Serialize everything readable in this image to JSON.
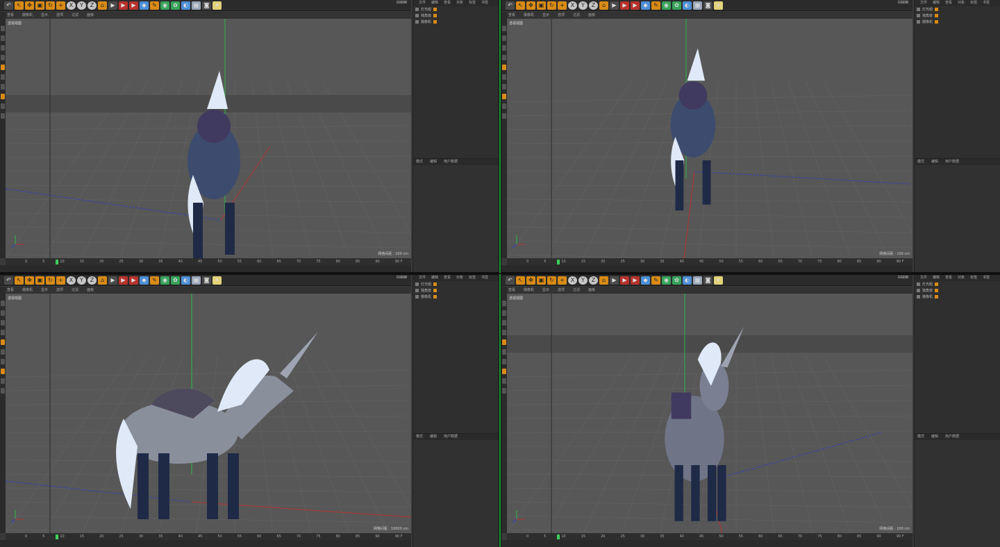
{
  "window": {
    "controls": "⊟⊞⊠"
  },
  "toolbar": {
    "icons": [
      "undo-icon",
      "select-icon",
      "move-icon",
      "scale-icon",
      "rotate-icon",
      "axis-icon",
      "x-axis-icon",
      "y-axis-icon",
      "z-axis-icon",
      "coords-icon",
      "render-icon",
      "render-settings-icon",
      "cube-icon",
      "pen-icon",
      "subdivide-icon",
      "mograph-icon",
      "deform-icon",
      "scene-icon",
      "camera-icon",
      "light-icon"
    ],
    "xyz": [
      "X",
      "Y",
      "Z"
    ]
  },
  "menu": {
    "items": [
      "查看",
      "摄像机",
      "显示",
      "选项",
      "过滤",
      "面板"
    ]
  },
  "viewport": {
    "label": "透视视图"
  },
  "object_manager": {
    "tabs": [
      "文件",
      "编辑",
      "查看",
      "对象",
      "标签",
      "书签"
    ],
    "rows": [
      "灯光组",
      "独角兽",
      "摄像机"
    ]
  },
  "attribute_manager": {
    "tabs": [
      "模式",
      "编辑",
      "用户数据"
    ]
  },
  "timeline": {
    "ticks": [
      "0",
      "5",
      "10",
      "15",
      "20",
      "25",
      "30",
      "35",
      "40",
      "45",
      "50",
      "55",
      "60",
      "65",
      "70",
      "75",
      "80",
      "85",
      "90"
    ],
    "frame": "90 F"
  },
  "quadrants": [
    {
      "name": "back-view",
      "scale": "网格间距 : 100 cm"
    },
    {
      "name": "rear-top-view",
      "scale": "网格间距 : 100 cm"
    },
    {
      "name": "side-view",
      "scale": "网格间距 : 10000 cm"
    },
    {
      "name": "front-view",
      "scale": "网格间距 : 100 cm"
    }
  ],
  "colors": {
    "accent": "#1b9e36",
    "orange": "#d98b16",
    "viewport_bg": "#575757",
    "panel_bg": "#2f2f2f"
  }
}
